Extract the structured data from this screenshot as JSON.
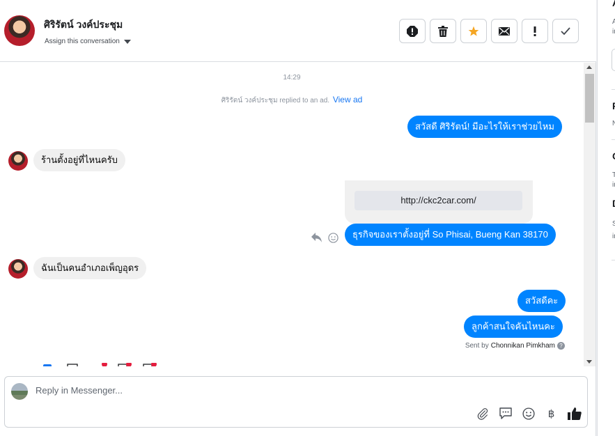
{
  "header": {
    "contact_name": "ศิริรัตน์ วงค์ประชุม",
    "assign_label": "Assign this conversation"
  },
  "actions": [
    {
      "name": "report-spam-icon"
    },
    {
      "name": "trash-icon"
    },
    {
      "name": "star-icon",
      "color": "#f5a623"
    },
    {
      "name": "mail-icon"
    },
    {
      "name": "follow-up-icon"
    },
    {
      "name": "check-icon"
    }
  ],
  "thread": {
    "timestamp": "14:29",
    "ad_note": "ศิริรัตน์ วงค์ประชุม replied to an ad.",
    "ad_link": "View ad",
    "messages": [
      {
        "from": "page",
        "text": "สวัสดี ศิริรัตน์! มีอะไรให้เราช่วยไหม"
      },
      {
        "from": "user",
        "text": "ร้านตั้งอยู่ที่ไหนครับ"
      },
      {
        "from": "page",
        "link": "http://ckc2car.com/"
      },
      {
        "from": "page",
        "text": "ธุรกิจของเราตั้งอยู่ที่ So Phisai, Bueng Kan 38170"
      },
      {
        "from": "user",
        "text": "ฉันเป็นคนอำเภอเพ็ญอุดร"
      },
      {
        "from": "page",
        "text": "สวัสดีคะ"
      },
      {
        "from": "page",
        "text": "ลูกค้าสนใจคันไหนคะ"
      }
    ],
    "sent_by_prefix": "Sent by",
    "sent_by_name": "Chonnikan Pimkham"
  },
  "composer": {
    "placeholder": "Reply in Messenger...",
    "tools": [
      "paperclip-icon",
      "saved-reply-icon",
      "emoji-icon",
      "baht-icon",
      "thumbs-up-icon"
    ],
    "baht_glyph": "฿"
  },
  "sidebar_peek": {
    "c1": "A",
    "c2": "A",
    "c3": "in",
    "c4": "F",
    "c5": "N",
    "c6": "C",
    "c7": "T",
    "c8": "in",
    "c9": "D",
    "c10": "S",
    "c11": "in"
  },
  "colors": {
    "outgoing": "#0084ff",
    "incoming": "#f0f0f0",
    "link": "#1877f2"
  }
}
